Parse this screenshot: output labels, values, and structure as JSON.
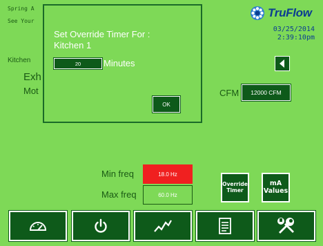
{
  "background": {
    "line1": "Spring A",
    "line2": "See Your",
    "kitchen_label": "Kitchen",
    "exh_label": "Exh",
    "mot_label": "Mot"
  },
  "header": {
    "logo_text": "TruFlow",
    "date": "03/25/2014",
    "time": "2:39:10pm"
  },
  "cfm": {
    "label": "CFM",
    "value": "12000 CFM"
  },
  "frequency": {
    "min_label": "Min freq",
    "min_value": "18.0 Hz",
    "max_label": "Max freq",
    "max_value": "60.0 Hz"
  },
  "side_buttons": {
    "override_line1": "Override",
    "override_line2": "Timer",
    "ma_line1": "mA",
    "ma_line2": "Values"
  },
  "toolbar": {
    "items": [
      {
        "icon": "gauge-icon"
      },
      {
        "icon": "power-icon"
      },
      {
        "icon": "trend-icon"
      },
      {
        "icon": "document-icon"
      },
      {
        "icon": "tools-icon"
      }
    ]
  },
  "dialog": {
    "title_line1": "Set Override Timer For :",
    "title_line2": "Kitchen 1",
    "minutes_value": "20",
    "minutes_label": "Minutes",
    "ok_label": "OK"
  },
  "colors": {
    "background": "#7ED957",
    "button_fill": "#0E5A1A",
    "alarm_red": "#F02020",
    "logo_blue": "#0B3D91"
  }
}
